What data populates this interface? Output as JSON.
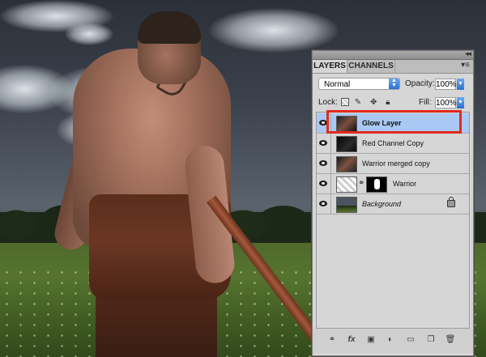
{
  "panel": {
    "tabs": [
      {
        "label": "LAYERS",
        "active": true
      },
      {
        "label": "CHANNELS",
        "active": false
      }
    ],
    "collapse_glyph": "◂◂",
    "menu_glyph": "▾≡",
    "blend_mode": "Normal",
    "opacity_label": "Opacity:",
    "opacity_value": "100%",
    "lock_label": "Lock:",
    "fill_label": "Fill:",
    "fill_value": "100%",
    "layers": [
      {
        "name": "Glow Layer",
        "selected": true,
        "style": "bold",
        "thumb_icon": "warrior-thumbnail"
      },
      {
        "name": "Red Channel Copy",
        "selected": false,
        "style": "normal",
        "thumb_icon": "dark-thumbnail"
      },
      {
        "name": "Warrior merged copy",
        "selected": false,
        "style": "normal",
        "thumb_icon": "warrior-thumbnail"
      },
      {
        "name": "Warrior",
        "selected": false,
        "style": "normal",
        "thumb_icon": "warrior-with-mask-thumbnail"
      },
      {
        "name": "Background",
        "selected": false,
        "style": "italic",
        "thumb_icon": "landscape-thumbnail",
        "locked": true
      }
    ],
    "footer_tools": [
      "link-icon",
      "fx-icon",
      "mask-icon",
      "adjustment-icon",
      "folder-icon",
      "new-layer-icon",
      "trash-icon"
    ]
  },
  "colors": {
    "selection_blue": "#a9c9f4",
    "highlight_red": "#e02a1e",
    "panel_gray": "#d6d6d6"
  }
}
